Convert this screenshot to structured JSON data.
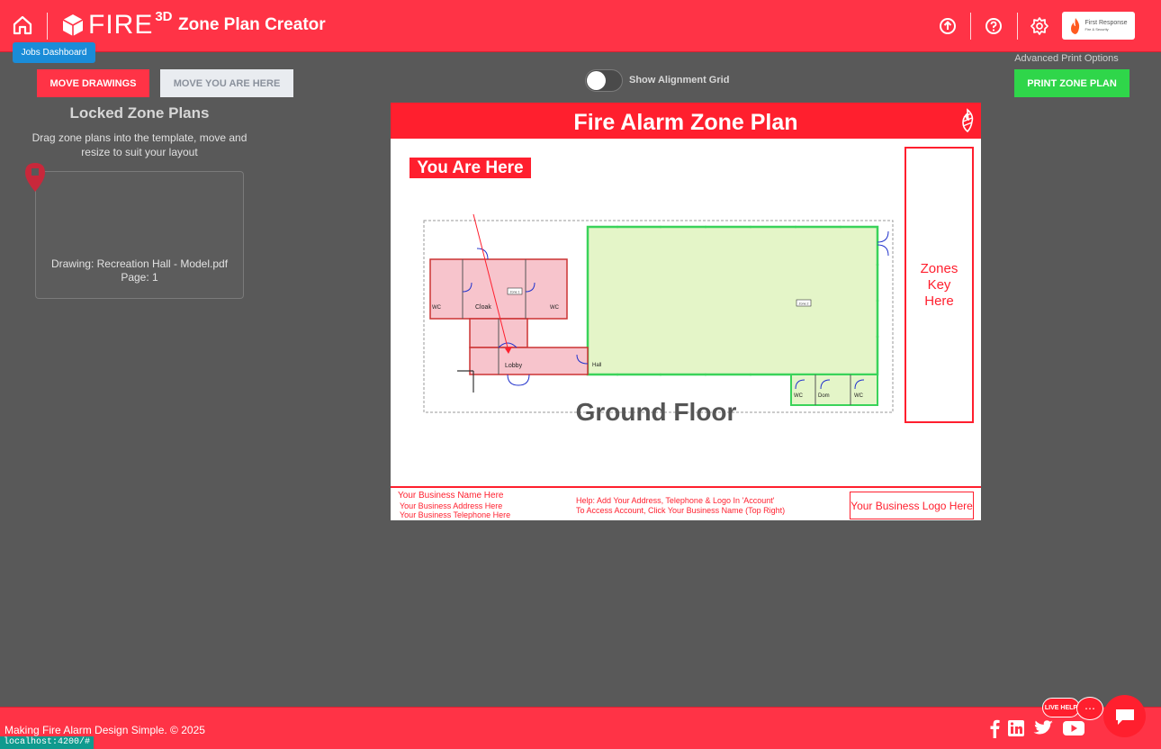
{
  "header": {
    "logo_text": "FIRE",
    "logo_sup": "3D",
    "title": "Zone Plan Creator",
    "account_name_line1": "First Response",
    "account_name_line2": "Fire & Security",
    "icons": [
      "home-icon",
      "upload-icon",
      "help-icon",
      "settings-icon"
    ]
  },
  "tooltip": {
    "text": "Jobs Dashboard"
  },
  "left_panel": {
    "move_drawings_label": "MOVE DRAWINGS",
    "move_here_label": "MOVE YOU ARE HERE",
    "title": "Locked Zone Plans",
    "description": "Drag zone plans into the template, move and resize to suit your layout",
    "card": {
      "drawing": "Drawing: Recreation Hall - Model.pdf",
      "page": "Page: 1"
    }
  },
  "toolbar": {
    "alignment_grid_label": "Show Alignment Grid",
    "alignment_grid_on": false,
    "advanced_print_label": "Advanced Print Options",
    "print_label": "PRINT ZONE PLAN"
  },
  "sheet": {
    "title": "Fire Alarm Zone Plan",
    "you_are_here": "You Are Here",
    "zones_key": "Zones Key Here",
    "floor_label": "Ground Floor",
    "rooms": {
      "wc1": "WC",
      "cloak": "Cloak",
      "wc2": "WC",
      "lobby": "Lobby",
      "hall": "Hall",
      "wc3": "WC",
      "dom": "Dom",
      "wc4": "WC",
      "zone1": "Zone 1",
      "zone2": "Zone 2"
    },
    "footer": {
      "business_name": "Your Business Name Here",
      "business_address": "Your Business Address Here",
      "business_phone": "Your Business Telephone Here",
      "help_line1": "Help: Add Your Address, Telephone & Logo In 'Account'",
      "help_line2": "To Access Account, Click Your Business Name (Top Right)",
      "logo_placeholder": "Your Business Logo Here"
    },
    "colors": {
      "accent": "#ff1f2e",
      "zone_green": "#e4f5c8",
      "zone_pink": "#f7c4cc"
    }
  },
  "footer": {
    "copyright": "Making Fire Alarm Design Simple. © 2025",
    "url": "localhost:4200/#",
    "live_help": "LIVE HELP",
    "social": [
      "facebook-icon",
      "linkedin-icon",
      "twitter-icon",
      "youtube-icon"
    ]
  },
  "colors": {
    "brand_red": "#ff3346",
    "print_green": "#2fd64a",
    "tooltip_blue": "#1a8cd8",
    "background": "#595959"
  }
}
